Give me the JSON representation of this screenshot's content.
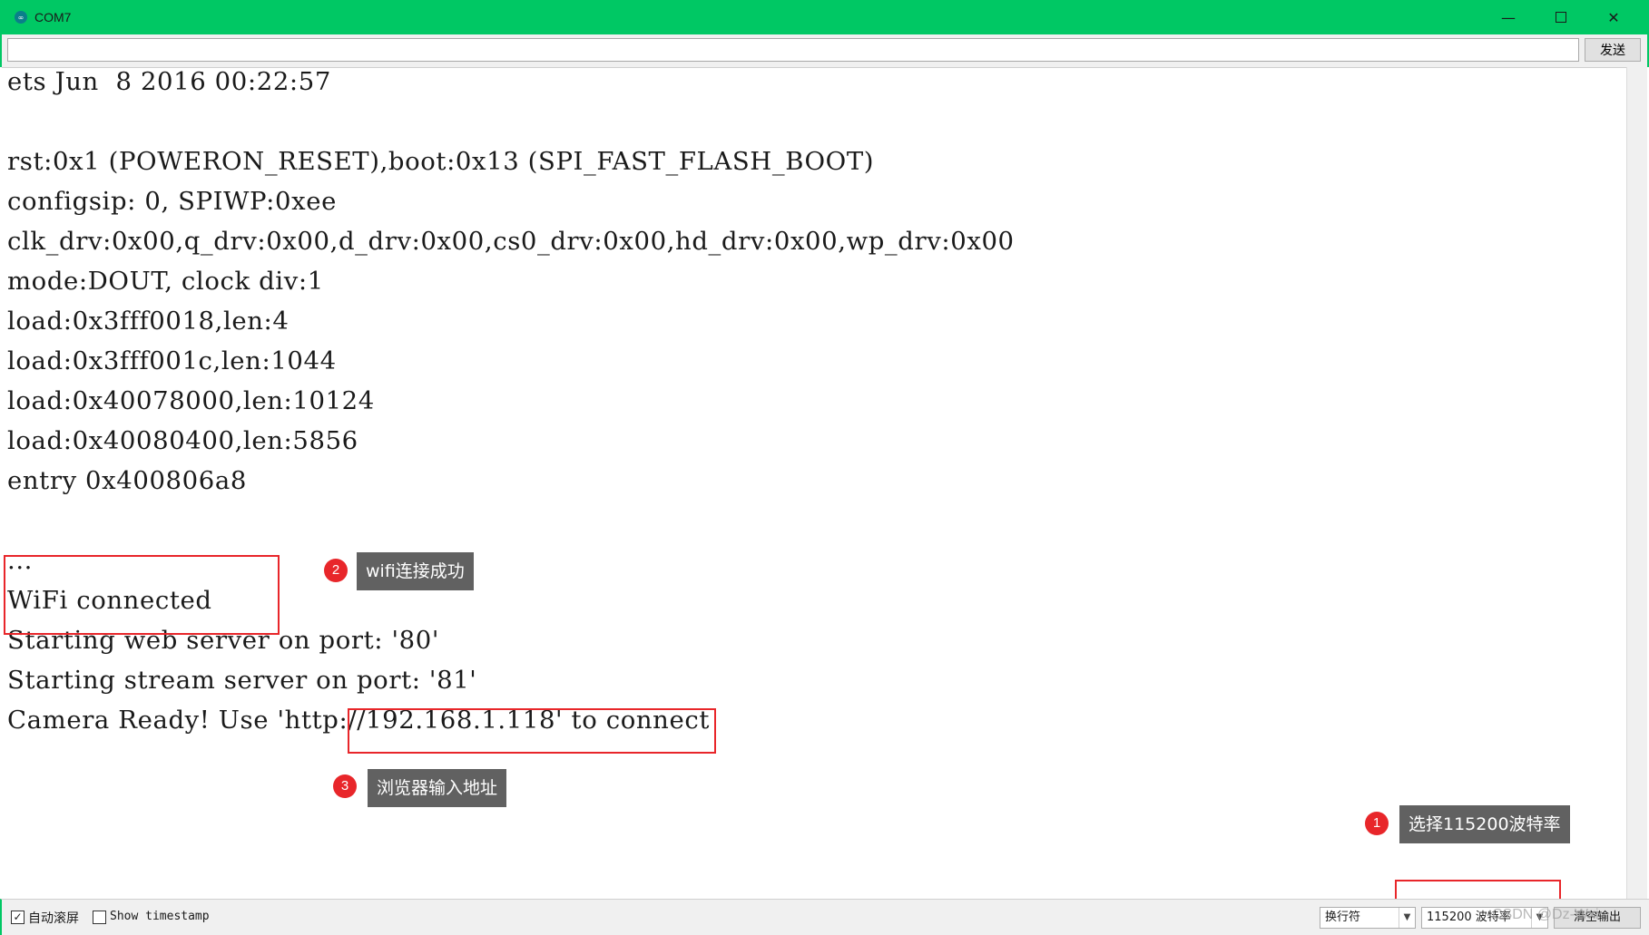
{
  "window": {
    "title": "COM7",
    "app_icon_glyph": "∞"
  },
  "input": {
    "value": "",
    "send_label": "发送"
  },
  "output_lines": [
    "ets Jun  8 2016 00:22:57",
    "",
    "rst:0x1 (POWERON_RESET),boot:0x13 (SPI_FAST_FLASH_BOOT)",
    "configsip: 0, SPIWP:0xee",
    "clk_drv:0x00,q_drv:0x00,d_drv:0x00,cs0_drv:0x00,hd_drv:0x00,wp_drv:0x00",
    "mode:DOUT, clock div:1",
    "load:0x3fff0018,len:4",
    "load:0x3fff001c,len:1044",
    "load:0x40078000,len:10124",
    "load:0x40080400,len:5856",
    "entry 0x400806a8",
    "",
    "...",
    "WiFi connected",
    "Starting web server on port: '80'",
    "Starting stream server on port: '81'",
    "Camera Ready! Use 'http://192.168.1.118' to connect"
  ],
  "bottom_bar": {
    "autoscroll_label": "自动滚屏",
    "autoscroll_checked": true,
    "timestamp_label": "Show timestamp",
    "timestamp_checked": false,
    "line_ending": "换行符",
    "baud_rate": "115200 波特率",
    "clear_label": "清空输出"
  },
  "annotations": [
    {
      "number": "1",
      "text": "选择115200波特率"
    },
    {
      "number": "2",
      "text": "wifi连接成功"
    },
    {
      "number": "3",
      "text": "浏览器输入地址"
    }
  ],
  "watermark": "CSDN @Dz-Wxi",
  "colors": {
    "titlebar": "#00c864",
    "annotation_red": "#e8262a",
    "tooltip_bg": "#616161"
  }
}
